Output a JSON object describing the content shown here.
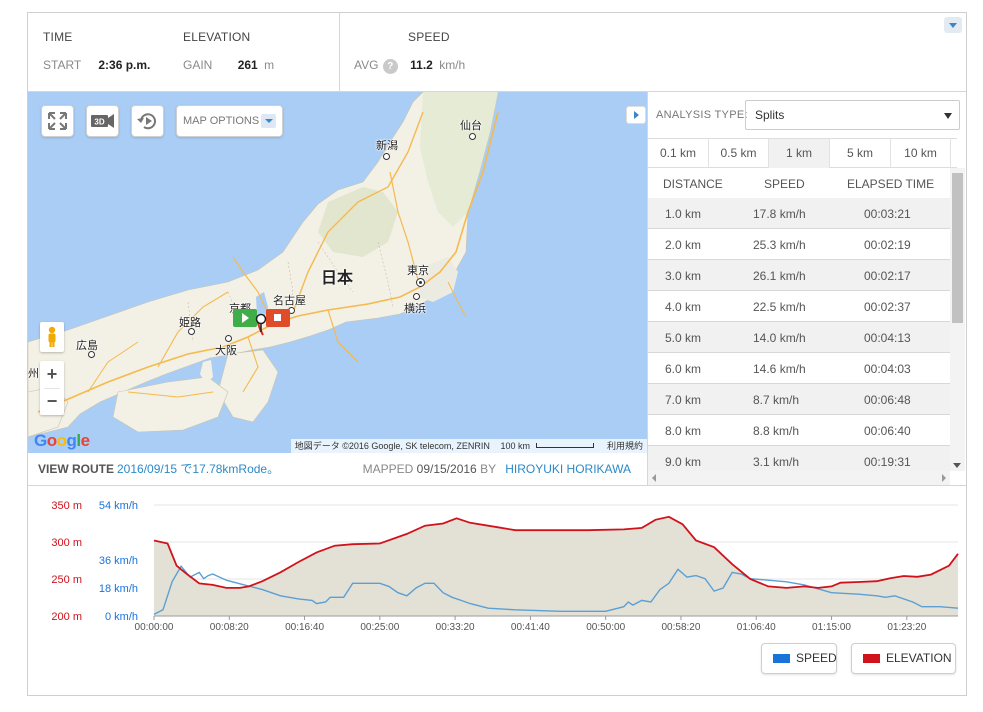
{
  "stats": {
    "time_header": "TIME",
    "start_label": "START",
    "start_value": "2:36 p.m.",
    "elevation_header": "ELEVATION",
    "gain_label": "GAIN",
    "gain_value": "261",
    "gain_unit": "m",
    "speed_header": "SPEED",
    "avg_label": "AVG",
    "avg_help": "?",
    "avg_value": "11.2",
    "avg_unit": "km/h"
  },
  "map": {
    "options_label": "MAP OPTIONS",
    "btn_3d": "3D",
    "zoom_in": "+",
    "zoom_out": "−",
    "country_label": "日本",
    "cities": {
      "sendai": "仙台",
      "niigata": "新潟",
      "tokyo": "東京",
      "yokohama": "横浜",
      "nagoya": "名古屋",
      "kyoto": "京都",
      "himeji": "姫路",
      "osaka": "大阪",
      "hiroshima": "広島",
      "kyushu_fragment": "州"
    },
    "attribution": "地図データ ©2016 Google, SK telecom, ZENRIN",
    "scale": "100 km",
    "terms": "利用規約",
    "google_letters": [
      "G",
      "o",
      "o",
      "g",
      "l",
      "e"
    ]
  },
  "route": {
    "view_route_label": "VIEW ROUTE",
    "route_link": "2016/09/15 で17.78kmRode。",
    "mapped_label": "MAPPED",
    "mapped_date": "09/15/2016",
    "by_label": "BY",
    "author": "HIROYUKI HORIKAWA"
  },
  "analysis": {
    "type_label": "ANALYSIS TYPE:",
    "type_value": "Splits",
    "distance_tabs": [
      "0.1 km",
      "0.5 km",
      "1 km",
      "5 km",
      "10 km"
    ],
    "active_tab": "1 km",
    "columns": [
      "DISTANCE",
      "SPEED",
      "ELAPSED TIME"
    ],
    "rows": [
      {
        "distance": "1.0 km",
        "speed": "17.8 km/h",
        "elapsed": "00:03:21"
      },
      {
        "distance": "2.0 km",
        "speed": "25.3 km/h",
        "elapsed": "00:02:19"
      },
      {
        "distance": "3.0 km",
        "speed": "26.1 km/h",
        "elapsed": "00:02:17"
      },
      {
        "distance": "4.0 km",
        "speed": "22.5 km/h",
        "elapsed": "00:02:37"
      },
      {
        "distance": "5.0 km",
        "speed": "14.0 km/h",
        "elapsed": "00:04:13"
      },
      {
        "distance": "6.0 km",
        "speed": "14.6 km/h",
        "elapsed": "00:04:03"
      },
      {
        "distance": "7.0 km",
        "speed": "8.7 km/h",
        "elapsed": "00:06:48"
      },
      {
        "distance": "8.0 km",
        "speed": "8.8 km/h",
        "elapsed": "00:06:40"
      },
      {
        "distance": "9.0 km",
        "speed": "3.1 km/h",
        "elapsed": "00:19:31"
      }
    ]
  },
  "legend": {
    "speed": "SPEED",
    "elevation": "ELEVATION"
  },
  "colors": {
    "speed": "#1a73d9",
    "speed_line": "#5b9fd4",
    "elevation": "#d0121b",
    "area_fill": "#e3e1d6",
    "link": "#2a8ac8"
  },
  "chart_data": {
    "type": "line",
    "elevation_axis": {
      "unit": "m",
      "ticks": [
        200,
        250,
        300,
        350
      ],
      "tick_labels": [
        "200 m",
        "250 m",
        "300 m",
        "350 m"
      ]
    },
    "speed_axis": {
      "unit": "km/h",
      "ticks": [
        0,
        18,
        36,
        54
      ],
      "tick_labels": [
        "0 km/h",
        "18 km/h",
        "36 km/h",
        "54 km/h"
      ]
    },
    "x_tick_labels": [
      "00:00:00",
      "00:08:20",
      "00:16:40",
      "00:25:00",
      "00:33:20",
      "00:41:40",
      "00:50:00",
      "00:58:20",
      "01:06:40",
      "01:15:00",
      "01:23:20"
    ],
    "x_range_minutes": [
      0,
      89
    ],
    "series": [
      {
        "name": "ELEVATION",
        "unit": "m",
        "x_minutes": [
          0,
          1.5,
          2.5,
          3.5,
          5,
          6.5,
          8,
          9.5,
          10.5,
          12,
          14,
          16,
          18,
          20,
          22,
          25,
          28,
          30,
          32,
          33.5,
          35,
          38,
          40,
          42,
          45,
          48,
          52,
          54,
          55.5,
          57,
          58.5,
          60,
          62,
          64,
          66,
          68,
          70,
          72,
          73.5,
          75,
          76,
          78,
          80,
          81.5,
          83,
          84.5,
          86,
          88,
          89
        ],
        "values": [
          302,
          298,
          268,
          258,
          244,
          242,
          238,
          238,
          240,
          247,
          259,
          273,
          286,
          295,
          297,
          298,
          311,
          322,
          325,
          332,
          326,
          320,
          316,
          316,
          316,
          316,
          317,
          319,
          330,
          334,
          324,
          302,
          293,
          270,
          250,
          240,
          238,
          240,
          238,
          240,
          245,
          246,
          247,
          251,
          254,
          253,
          256,
          268,
          284
        ]
      },
      {
        "name": "SPEED",
        "unit": "km/h",
        "x_minutes": [
          0,
          1,
          2,
          3,
          4,
          5,
          5.5,
          6,
          6.5,
          8,
          10,
          12,
          14,
          16,
          17.5,
          18,
          19,
          19.5,
          21,
          22,
          24,
          25,
          26,
          27,
          28,
          29,
          30,
          31,
          32,
          33,
          34,
          35,
          37,
          40,
          45,
          50,
          52,
          52.5,
          53,
          54,
          55,
          56,
          57,
          58,
          59,
          60,
          61,
          62,
          63,
          64,
          65,
          66,
          68,
          70,
          72,
          75,
          78,
          80,
          81,
          82,
          84,
          85,
          87,
          89
        ],
        "values": [
          1,
          4,
          22,
          32,
          25,
          28,
          24,
          26,
          27,
          23,
          20,
          17,
          13,
          11,
          10,
          8,
          9,
          12,
          12,
          21,
          21,
          21,
          19,
          15,
          13,
          18,
          21,
          21,
          15,
          12,
          10,
          8,
          5,
          4,
          3,
          3,
          6,
          9,
          7,
          10,
          9,
          17,
          21,
          30,
          25,
          26,
          24,
          16,
          18,
          28,
          27,
          24,
          23,
          22,
          20,
          15,
          14,
          13,
          12,
          13,
          9,
          6,
          6,
          5
        ]
      }
    ]
  }
}
